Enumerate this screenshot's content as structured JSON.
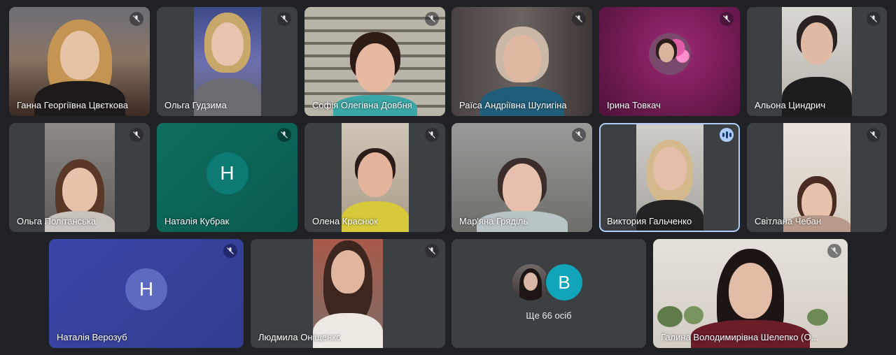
{
  "participants": [
    {
      "name": "Ганна Георгіївна Цвєткова",
      "muted": true
    },
    {
      "name": "Ольга Гудзима",
      "muted": true
    },
    {
      "name": "Софія Олегівна Довбня",
      "muted": true
    },
    {
      "name": "Раїса Андріївна Шулигіна",
      "muted": true
    },
    {
      "name": "Ірина Товкач",
      "muted": true
    },
    {
      "name": "Альона Циндрич",
      "muted": true
    },
    {
      "name": "Ольга Політанська",
      "muted": true
    },
    {
      "name": "Наталія Кубрак",
      "muted": true,
      "avatar_letter": "Н"
    },
    {
      "name": "Олена Краснюк",
      "muted": true
    },
    {
      "name": "Мар'яна Гряділь",
      "muted": true
    },
    {
      "name": "Виктория Гальченко",
      "speaking": true
    },
    {
      "name": "Світлана Чебан",
      "muted": true
    },
    {
      "name": "Наталія Верозуб",
      "muted": true,
      "avatar_letter": "Н"
    },
    {
      "name": "Людмила Оніщенко",
      "muted": true
    },
    {
      "name": "Галина Володимирівна Шелепко (О..."
    }
  ],
  "more_people": {
    "label": "Ще 66 осіб",
    "avatar_letter": "В"
  },
  "colors": {
    "background": "#202124",
    "tile": "#3c4043",
    "speaking_outline": "#aecbfa",
    "teal_avatar_bg": "#0d7a73",
    "violet_avatar_bg": "#5c6bc0",
    "more_avatar_bg": "#12a4b8"
  },
  "icons": {
    "muted": "mic-off-icon",
    "speaking": "audio-level-icon"
  }
}
